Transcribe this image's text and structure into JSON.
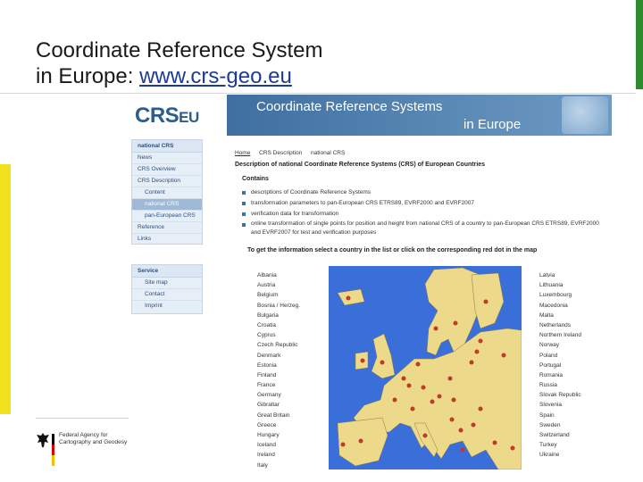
{
  "slide": {
    "title_line1": "Coordinate Reference System",
    "title_line2_prefix": "in Europe: ",
    "title_url": "www.crs-geo.eu",
    "agency_name": "Federal Agency for Cartography and Geodesy"
  },
  "site": {
    "logo_main": "CRS",
    "logo_suffix": "EU",
    "banner_line1": "Coordinate Reference Systems",
    "banner_line2": "in Europe",
    "sidebar": {
      "menu1_header": "national CRS",
      "menu1_items": [
        "News",
        "CRS Overview",
        "CRS Description",
        "Content",
        "national CRS",
        "pan-European CRS",
        "Reference",
        "Links"
      ],
      "menu2_header": "Service",
      "menu2_items": [
        "Site map",
        "Contact",
        "Imprint"
      ]
    },
    "breadcrumb": [
      "Home",
      "CRS Description",
      "national CRS"
    ],
    "page_heading": "Description of national Coordinate Reference Systems (CRS) of European Countries",
    "contains_label": "Contains",
    "contents": [
      "descriptions of Coordinate Reference Systems",
      "transformation parameters to pan-European CRS ETRS89, EVRF2000 and EVRF2007",
      "verification data for transformation",
      "online transformation of single points for position and height from national CRS of a country to pan-European CRS ETRS89, EVRF2000 and EVRF2007 for test and verification purposes"
    ],
    "get_info": "To get the information select a country in the list or click on the corresponding red dot in the map",
    "countries_left": [
      "Albania",
      "Austria",
      "Belgium",
      "Bosnia / Herzeg.",
      "Bulgaria",
      "Croatia",
      "Cyprus",
      "Czech Republic",
      "Denmark",
      "Estonia",
      "Finland",
      "France",
      "Germany",
      "Gibraltar",
      "Great Britain",
      "Greece",
      "Hungary",
      "Iceland",
      "Ireland",
      "Italy"
    ],
    "countries_right": [
      "Latvia",
      "Lithuania",
      "Luxembourg",
      "Macedonia",
      "Malta",
      "Netherlands",
      "Northern Ireland",
      "Norway",
      "Poland",
      "Portugal",
      "Romania",
      "Russia",
      "Slovak Republic",
      "Slovenia",
      "Spain",
      "Sweden",
      "Switzerland",
      "Turkey",
      "Ukraine"
    ]
  },
  "colors": {
    "accent_green": "#2e8b2e",
    "strip_yellow": "#f2e01c",
    "map_sea": "#3a6ed8",
    "map_land": "#ecd98a",
    "map_dot": "#c0392b",
    "banner_blue": "#3f6fa0"
  }
}
